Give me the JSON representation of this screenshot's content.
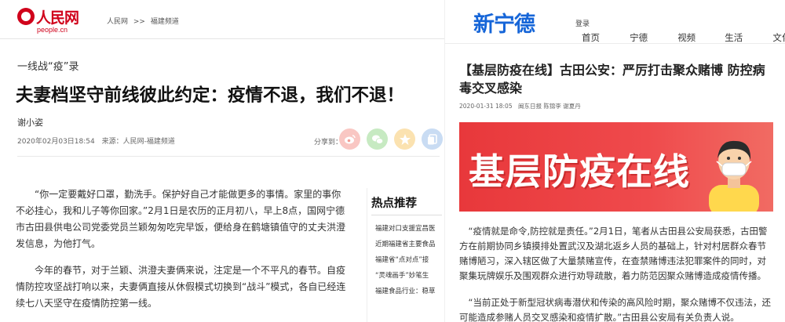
{
  "left": {
    "logo": {
      "cn": "人民网",
      "en": "people.cn",
      "color": "#d0021b"
    },
    "breadcrumb": [
      "人民网",
      ">>",
      "福建频道"
    ],
    "column": "一线战“疫”录",
    "title": "夫妻档坚守前线彼此约定：疫情不退，我们不退！",
    "author": "谢小姿",
    "meta": {
      "date": "2020年02月03日18:54",
      "source": "来源：人民网-福建频道"
    },
    "share": {
      "label": "分享到：",
      "icons": [
        "weibo-icon",
        "wechat-icon",
        "qzone-icon",
        "copy-icon"
      ]
    },
    "body": [
      "“你一定要戴好口罩，勤洗手。保护好自己才能做更多的事情。家里的事你不必挂心，我和儿子等你回家。”2月1日是农历的正月初八，早上8点，国网宁德市古田县供电公司党委党员兰颖匆匆吃完早饭，便给身在鹤塘镇值守的丈夫洪澄发信息，为他打气。",
      "今年的春节，对于兰颖、洪澄夫妻俩来说，注定是一个不平凡的春节。自疫情防控攻坚战打响以来，夫妻俩直接从休假模式切换到“战斗”模式，各自已经连续七八天坚守在疫情防控第一线。"
    ],
    "hot": {
      "title": "热点推荐",
      "items": [
        "福建对口支援宜昌医",
        "近期福建省主要食品",
        "福建省“点对点”接",
        "“灵魂画手”妙笔生",
        "福建食品行业：稳草"
      ]
    }
  },
  "right": {
    "logo": "新宁德",
    "login": "登录",
    "nav": [
      "首页",
      "宁德",
      "视频",
      "生活",
      "文化"
    ],
    "title": "【基层防疫在线】古田公安：严厉打击聚众赌博 防控病毒交叉感染",
    "meta": {
      "date": "2020-01-31 18:05",
      "source": "闽东日报 陈锦李 谢夏丹"
    },
    "banner_text": "基层防疫在线",
    "body": [
      "“疫情就是命令,防控就是责任。”2月1日，笔者从古田县公安局获悉，古田警方在前期协同乡镇摸排处置武汉及湖北返乡人员的基础上，针对村居群众春节赌博陋习，深入辖区做了大量禁赌宣传，在查禁赌博违法犯罪案件的同时，对聚集玩牌娱乐及围观群众进行劝导疏散，着力防范因聚众赌博造成疫情传播。",
      "“当前正处于新型冠状病毒潜伏和传染的高风险时期，聚众赌博不仅违法，还可能造成参赌人员交叉感染和疫情扩散。”古田县公安局有关负责人说。"
    ]
  }
}
